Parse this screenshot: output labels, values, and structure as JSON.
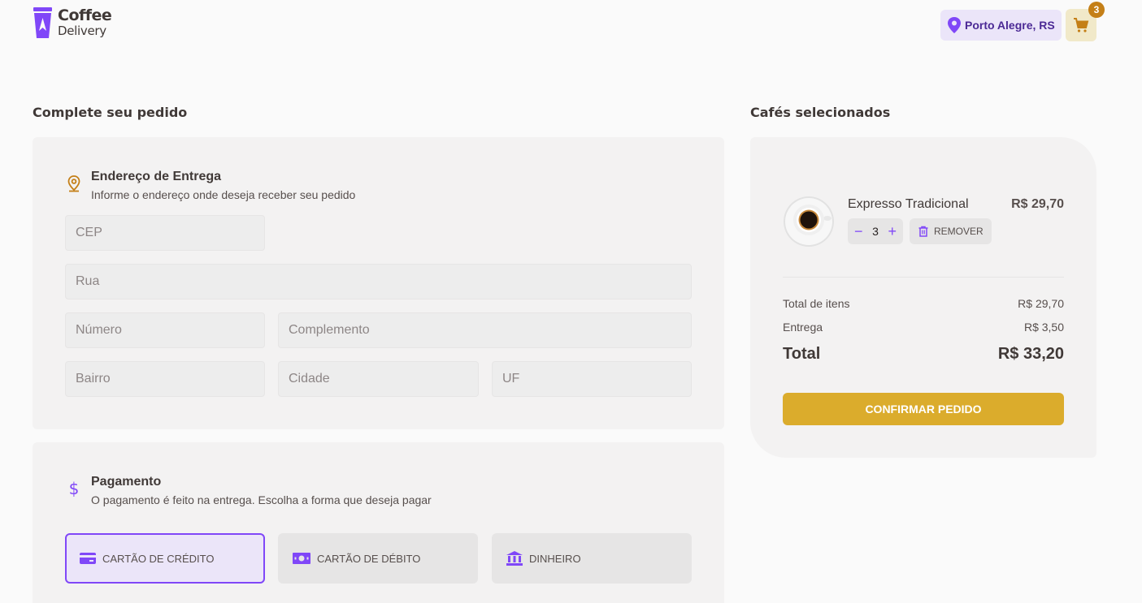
{
  "header": {
    "logo_line1": "Coffee",
    "logo_line2": "Delivery",
    "location": "Porto Alegre, RS",
    "cart_count": "3"
  },
  "checkout": {
    "title": "Complete seu pedido",
    "address": {
      "heading": "Endereço de Entrega",
      "subtitle": "Informe o endereço onde deseja receber seu pedido",
      "fields": {
        "cep": {
          "placeholder": "CEP",
          "value": ""
        },
        "rua": {
          "placeholder": "Rua",
          "value": ""
        },
        "numero": {
          "placeholder": "Número",
          "value": ""
        },
        "complemento": {
          "placeholder": "Complemento",
          "value": ""
        },
        "bairro": {
          "placeholder": "Bairro",
          "value": ""
        },
        "cidade": {
          "placeholder": "Cidade",
          "value": ""
        },
        "uf": {
          "placeholder": "UF",
          "value": ""
        }
      }
    },
    "payment": {
      "heading": "Pagamento",
      "subtitle": "O pagamento é feito na entrega. Escolha a forma que deseja pagar",
      "options": [
        {
          "label": "CARTÃO DE CRÉDITO",
          "icon": "credit-card-icon",
          "selected": true
        },
        {
          "label": "CARTÃO DE DÉBITO",
          "icon": "bank-note-icon",
          "selected": false
        },
        {
          "label": "DINHEIRO",
          "icon": "bank-icon",
          "selected": false
        }
      ]
    }
  },
  "selected": {
    "title": "Cafés selecionados",
    "items": [
      {
        "name": "Expresso Tradicional",
        "price": "R$ 29,70",
        "quantity": "3",
        "remove_label": "REMOVER"
      }
    ],
    "summary": {
      "items_label": "Total de itens",
      "items_value": "R$ 29,70",
      "delivery_label": "Entrega",
      "delivery_value": "R$ 3,50",
      "total_label": "Total",
      "total_value": "R$ 33,20"
    },
    "confirm_label": "CONFIRMAR PEDIDO"
  },
  "colors": {
    "purple": "#8047F8",
    "purple_dark": "#4B2995",
    "yellow": "#DBAC2C",
    "yellow_dark": "#C47F17"
  }
}
